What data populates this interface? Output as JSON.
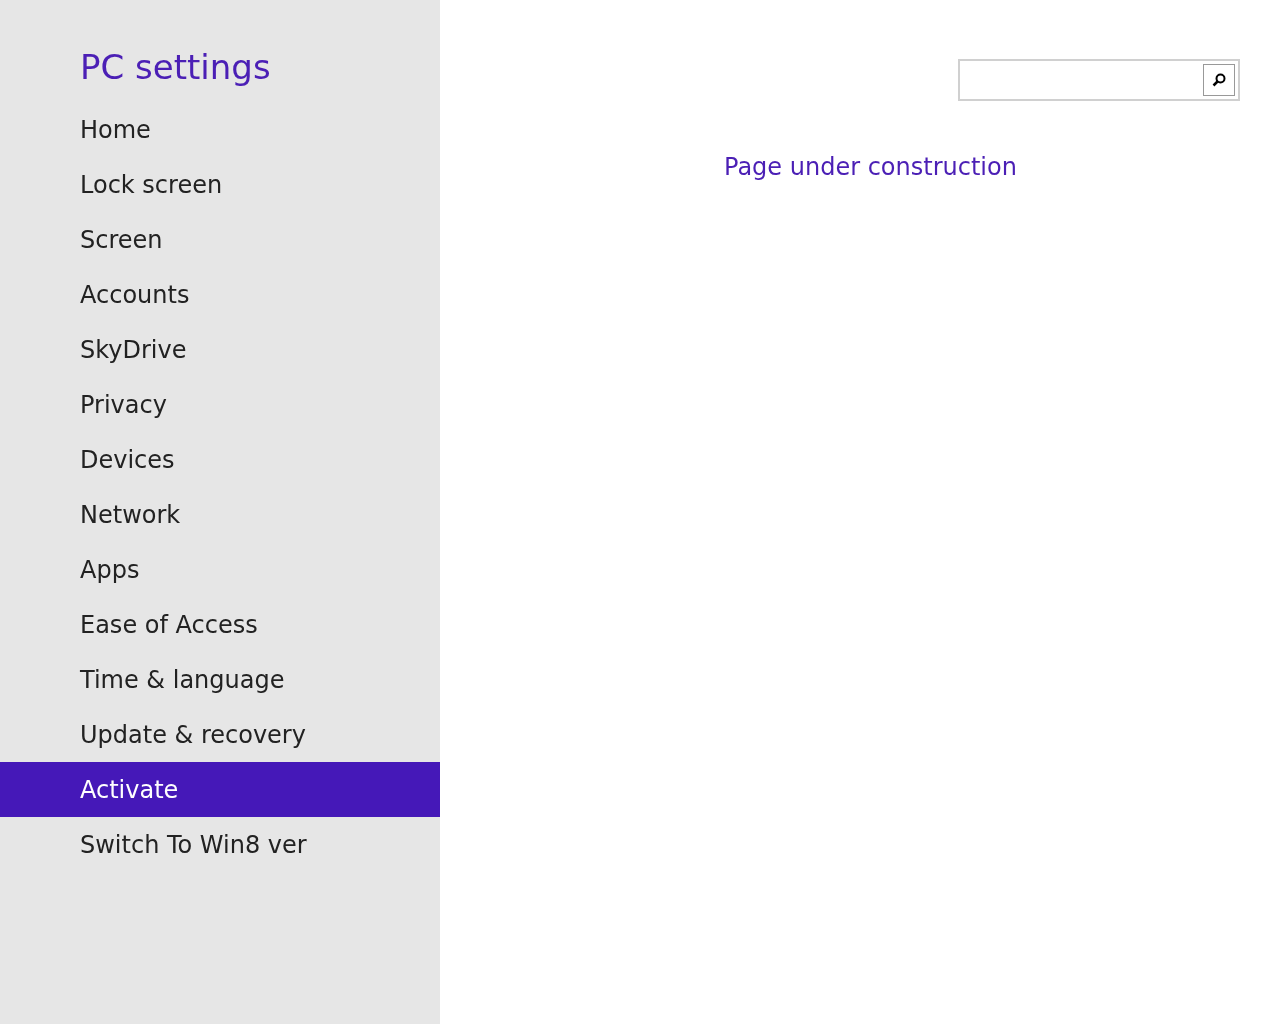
{
  "sidebar": {
    "title": "PC settings",
    "items": [
      {
        "label": "Home",
        "selected": false
      },
      {
        "label": "Lock screen",
        "selected": false
      },
      {
        "label": "Screen",
        "selected": false
      },
      {
        "label": "Accounts",
        "selected": false
      },
      {
        "label": "SkyDrive",
        "selected": false
      },
      {
        "label": "Privacy",
        "selected": false
      },
      {
        "label": "Devices",
        "selected": false
      },
      {
        "label": "Network",
        "selected": false
      },
      {
        "label": "Apps",
        "selected": false
      },
      {
        "label": "Ease of Access",
        "selected": false
      },
      {
        "label": "Time & language",
        "selected": false
      },
      {
        "label": "Update & recovery",
        "selected": false
      },
      {
        "label": "Activate",
        "selected": true
      },
      {
        "label": "Switch To Win8 ver",
        "selected": false
      }
    ]
  },
  "content": {
    "message": "Page under construction"
  }
}
